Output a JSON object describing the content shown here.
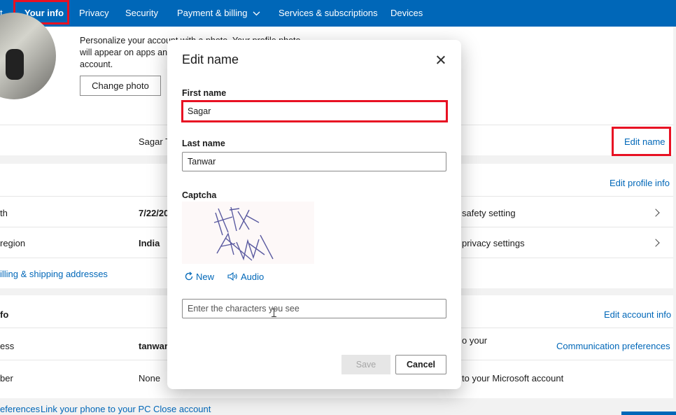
{
  "nav": {
    "items": [
      {
        "label": "t",
        "active": false
      },
      {
        "label": "Your info",
        "active": true
      },
      {
        "label": "Privacy",
        "active": false
      },
      {
        "label": "Security",
        "active": false
      },
      {
        "label": "Payment & billing",
        "active": false
      },
      {
        "label": "Services & subscriptions",
        "active": false
      },
      {
        "label": "Devices",
        "active": false
      }
    ],
    "dropdown_icon": "chevron-down-icon"
  },
  "profile": {
    "photo_text": "Personalize your account with a photo. Your profile photo will appear on apps and devices that use your Microsoft account.",
    "change_photo_label": "Change photo",
    "full_name": "Sagar T",
    "edit_name_link": "Edit name"
  },
  "profile_info": {
    "edit_link": "Edit profile info",
    "rows": [
      {
        "label": "th",
        "value": "7/22/20",
        "right": "safety setting"
      },
      {
        "label": "region",
        "value": "India",
        "right": "privacy settings"
      }
    ],
    "addresses_link": "illing & shipping addresses"
  },
  "account_info": {
    "heading": "fo",
    "edit_link": "Edit account info",
    "rows": [
      {
        "label": "ess",
        "value": "tanwars",
        "right": "o your",
        "link": "Communication preferences"
      },
      {
        "label": "ber",
        "value": "None",
        "right": "to your Microsoft account"
      }
    ]
  },
  "footer_links": [
    "eferences",
    "Link your phone to your PC",
    "Close account"
  ],
  "modal": {
    "title": "Edit name",
    "first_name_label": "First name",
    "first_name_value": "Sagar",
    "last_name_label": "Last name",
    "last_name_value": "Tanwar",
    "captcha_label": "Captcha",
    "captcha_text": "HX AAW",
    "new_label": "New",
    "audio_label": "Audio",
    "captcha_placeholder": "Enter the characters you see",
    "save_label": "Save",
    "cancel_label": "Cancel"
  },
  "colors": {
    "accent": "#0067b8",
    "highlight": "#e81123",
    "disabled_bg": "#e6e6e6"
  }
}
